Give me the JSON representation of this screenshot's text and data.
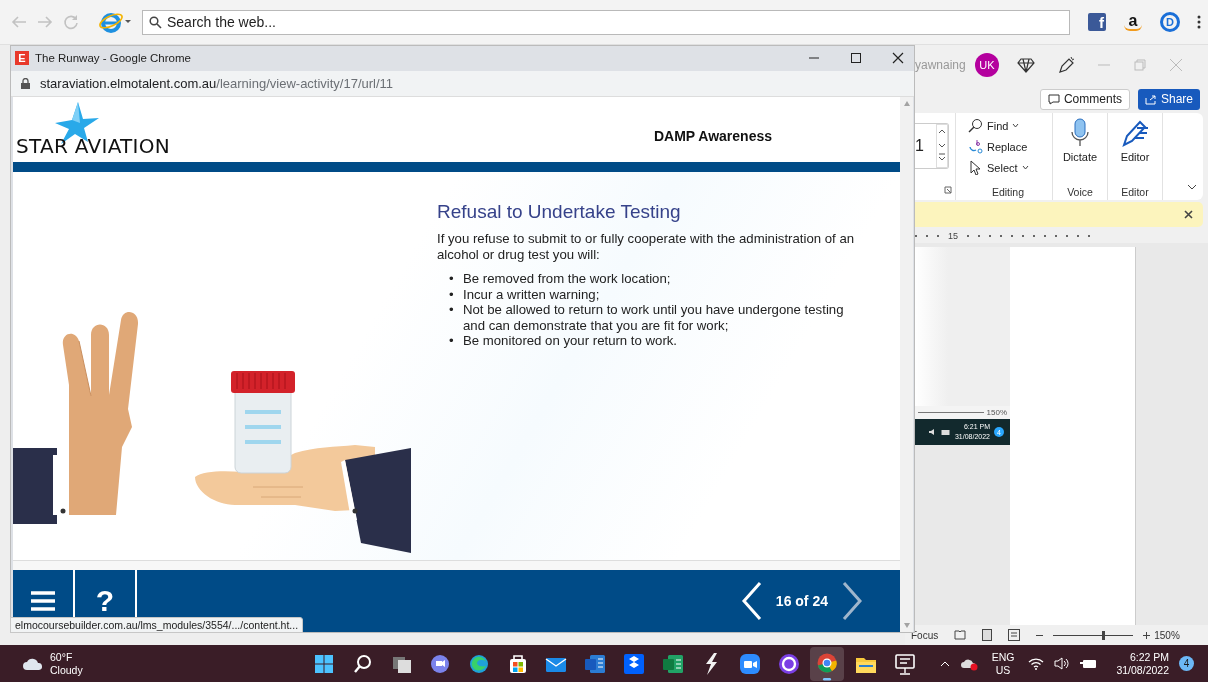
{
  "browser_toolbar": {
    "search": {
      "placeholder": "Search the web..."
    },
    "extensions": [
      {
        "kind": "facebook",
        "glyph": "f"
      },
      {
        "kind": "amazon",
        "glyph": "a"
      },
      {
        "kind": "circle",
        "glyph": "D"
      }
    ]
  },
  "word_window": {
    "user": "yawnaing",
    "avatar": "UK",
    "comments": "Comments",
    "share": "Share",
    "font_size": "1",
    "groups": [
      {
        "label": "Editing",
        "items": [
          {
            "kind": "find",
            "label": "Find",
            "dropdown": true
          },
          {
            "kind": "replace",
            "label": "Replace",
            "dropdown": false
          },
          {
            "kind": "select",
            "label": "Select",
            "dropdown": true
          }
        ]
      },
      {
        "label": "Voice",
        "items": [
          {
            "kind": "dictate",
            "label": "Dictate",
            "dropdown": false
          }
        ]
      },
      {
        "label": "Editor",
        "items": [
          {
            "kind": "editor",
            "label": "Editor",
            "dropdown": false
          }
        ]
      }
    ],
    "ruler_number": "15",
    "inserted_screenshot": {
      "zoom": "150%",
      "time": "6:21 PM",
      "date": "31/08/2022",
      "badge": "4"
    },
    "status_bar": {
      "focus": "Focus",
      "zoom_slider": {
        "level": 0.62
      },
      "zoom": "150%"
    }
  },
  "chrome_window": {
    "title": "The Runway - Google Chrome",
    "favicon": "E",
    "url": {
      "host": "staraviation.elmotalent.com.au",
      "path": "/learning/view-activity/17/url/11"
    },
    "logo": "STAR AVIATION",
    "course_title": "DAMP Awareness",
    "slide": {
      "heading": "Refusal to Undertake Testing",
      "intro": "If you refuse to submit to or fully cooperate with the administration of an alcohol or drug test you will:",
      "bullets": [
        {
          "marker": "•",
          "text": "Be removed from the work location;"
        },
        {
          "marker": "•",
          "text": "Incur a written warning;"
        },
        {
          "marker": "•",
          "text": "Not be allowed to return to work until you have undergone testing and can demonstrate that you are fit for work;"
        },
        {
          "marker": "•",
          "text": "Be monitored on your return to work."
        }
      ]
    },
    "footer": {
      "help": "?",
      "page": "16 of 24",
      "nav": [
        {
          "kind": "prev",
          "disabled": false
        },
        {
          "kind": "next",
          "disabled": true
        }
      ]
    },
    "status_url": "elmocoursebuilder.com.au/lms_modules/3554/.../content.ht..."
  },
  "taskbar": {
    "weather": {
      "temperature": "60°F",
      "condition": "Cloudy"
    },
    "apps": [
      {
        "kind": "start",
        "selected": false
      },
      {
        "kind": "search",
        "selected": false
      },
      {
        "kind": "taskview",
        "selected": false
      },
      {
        "kind": "chat",
        "selected": false
      },
      {
        "kind": "edge",
        "selected": false
      },
      {
        "kind": "store",
        "selected": false
      },
      {
        "kind": "mail",
        "selected": false
      },
      {
        "kind": "word",
        "selected": false
      },
      {
        "kind": "dropbox",
        "selected": false
      },
      {
        "kind": "excel",
        "selected": false
      },
      {
        "kind": "bolt",
        "selected": false
      },
      {
        "kind": "zoom",
        "selected": false
      },
      {
        "kind": "ring",
        "selected": false
      },
      {
        "kind": "chrome",
        "selected": true
      },
      {
        "kind": "files",
        "selected": false
      },
      {
        "kind": "presenter",
        "selected": false
      }
    ],
    "language": {
      "code": "ENG",
      "region": "US"
    },
    "time": "6:22 PM",
    "date": "31/08/2022",
    "notifications": "4"
  }
}
